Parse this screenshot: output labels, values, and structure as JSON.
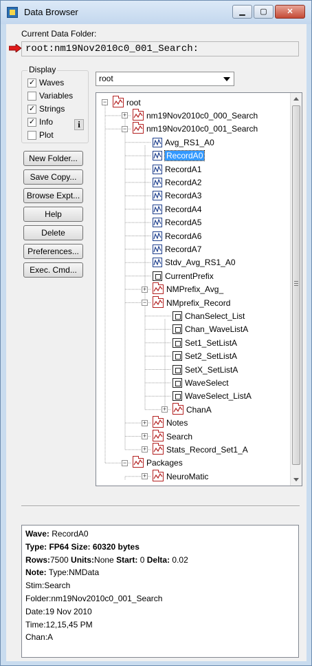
{
  "window": {
    "title": "Data Browser"
  },
  "current_folder": {
    "label": "Current Data Folder:",
    "path": "root:nm19Nov2010c0_001_Search:"
  },
  "display": {
    "legend": "Display",
    "options": [
      {
        "label": "Waves",
        "checked": true
      },
      {
        "label": "Variables",
        "checked": false
      },
      {
        "label": "Strings",
        "checked": true
      },
      {
        "label": "Info",
        "checked": true
      },
      {
        "label": "Plot",
        "checked": false
      }
    ],
    "info_icon": "i"
  },
  "buttons": [
    {
      "label": "New Folder..."
    },
    {
      "label": "Save Copy..."
    },
    {
      "label": "Browse Expt..."
    },
    {
      "label": "Help"
    },
    {
      "label": "Delete"
    },
    {
      "label": "Preferences..."
    },
    {
      "label": "Exec. Cmd..."
    }
  ],
  "folder_select": {
    "value": "root"
  },
  "tree": {
    "nodes": [
      {
        "label": "root",
        "type": "folder",
        "expander": "−"
      },
      {
        "label": "nm19Nov2010c0_000_Search",
        "type": "folder",
        "expander": "+"
      },
      {
        "label": "nm19Nov2010c0_001_Search",
        "type": "folder",
        "expander": "−",
        "current": true
      },
      {
        "label": "Avg_RS1_A0",
        "type": "wave"
      },
      {
        "label": "RecordA0",
        "type": "wave",
        "selected": true
      },
      {
        "label": "RecordA1",
        "type": "wave"
      },
      {
        "label": "RecordA2",
        "type": "wave"
      },
      {
        "label": "RecordA3",
        "type": "wave"
      },
      {
        "label": "RecordA4",
        "type": "wave"
      },
      {
        "label": "RecordA5",
        "type": "wave"
      },
      {
        "label": "RecordA6",
        "type": "wave"
      },
      {
        "label": "RecordA7",
        "type": "wave"
      },
      {
        "label": "Stdv_Avg_RS1_A0",
        "type": "wave"
      },
      {
        "label": "CurrentPrefix",
        "type": "string"
      },
      {
        "label": "NMPrefix_Avg_",
        "type": "folder",
        "expander": "+"
      },
      {
        "label": "NMprefix_Record",
        "type": "folder",
        "expander": "−"
      },
      {
        "label": "ChanSelect_List",
        "type": "string"
      },
      {
        "label": "Chan_WaveListA",
        "type": "string"
      },
      {
        "label": "Set1_SetListA",
        "type": "string"
      },
      {
        "label": "Set2_SetListA",
        "type": "string"
      },
      {
        "label": "SetX_SetListA",
        "type": "string"
      },
      {
        "label": "WaveSelect",
        "type": "string"
      },
      {
        "label": "WaveSelect_ListA",
        "type": "string"
      },
      {
        "label": "ChanA",
        "type": "folder",
        "expander": "+"
      },
      {
        "label": "Notes",
        "type": "folder",
        "expander": "+"
      },
      {
        "label": "Search",
        "type": "folder",
        "expander": "+"
      },
      {
        "label": "Stats_Record_Set1_A",
        "type": "folder",
        "expander": "+"
      },
      {
        "label": "Packages",
        "type": "folder",
        "expander": "−"
      },
      {
        "label": "NeuroMatic",
        "type": "folder",
        "expander": "+"
      }
    ]
  },
  "info": {
    "wave_label": "Wave:",
    "wave": " RecordA0",
    "type_label": "Type:",
    "type": " FP64  ",
    "size_label": "Size:",
    "size": " 60320 bytes",
    "rows_label": "Rows:",
    "rows": "7500 ",
    "units_label": "Units:",
    "units": "None ",
    "start_label": "Start:",
    "start": " 0 ",
    "delta_label": "Delta:",
    "delta": " 0.02",
    "note_label": "Note:",
    "note": " Type:NMData",
    "lines": [
      "Stim:Search",
      "Folder:nm19Nov2010c0_001_Search",
      "Date:19 Nov 2010",
      "Time:12,15,45 PM",
      "Chan:A"
    ]
  },
  "colors": {
    "selection": "#3399ff",
    "pointer_arrow": "#e01b1b",
    "wave_icon": "#1d3e8c",
    "folder_icon": "#b32020"
  }
}
